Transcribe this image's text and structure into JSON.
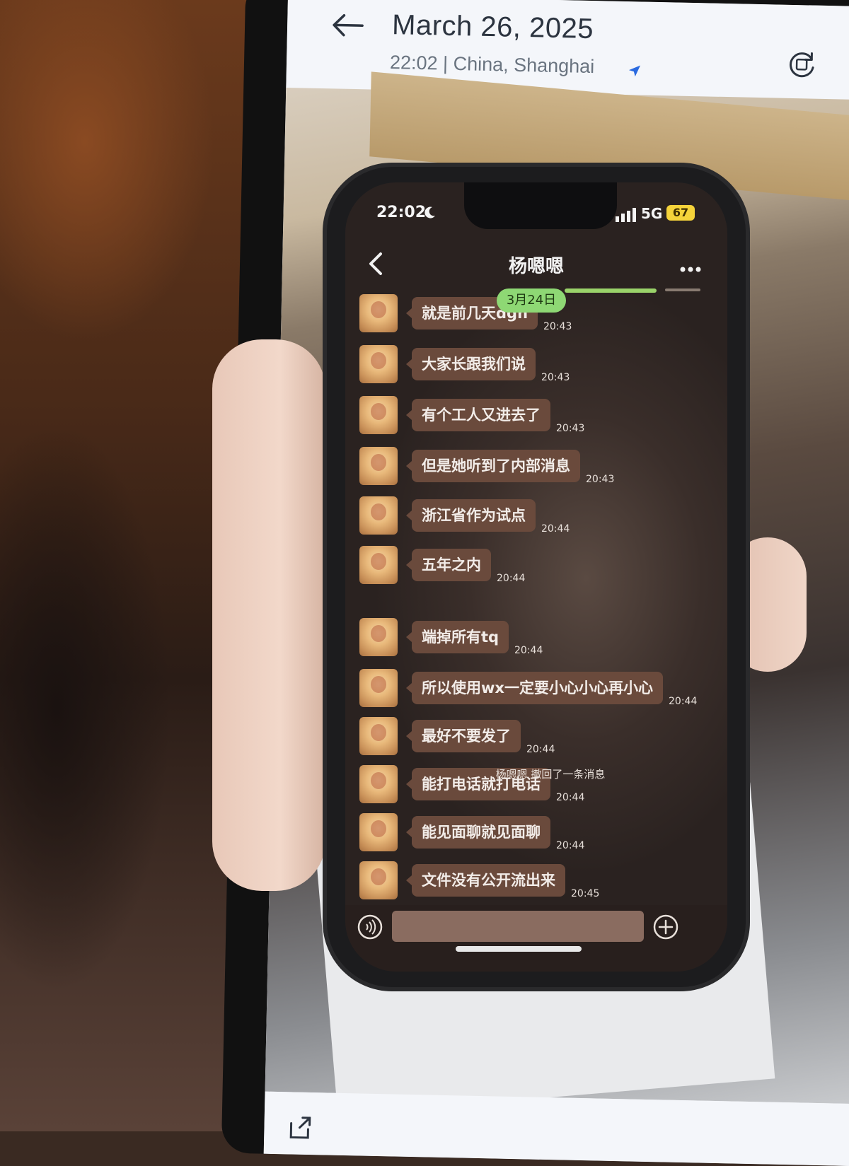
{
  "viewer": {
    "date": "March 26, 2025",
    "location": "22:02 | China, Shanghai"
  },
  "inner_phone": {
    "status_time": "22:02",
    "network": "5G",
    "battery": "67"
  },
  "chat": {
    "title": "杨嗯嗯",
    "date_chip": "3月24日",
    "recall_notice": "杨嗯嗯 撤回了一条消息",
    "messages": [
      {
        "text": "就是前几天dgh",
        "time": "20:43"
      },
      {
        "text": "大家长跟我们说",
        "time": "20:43"
      },
      {
        "text": "有个工人又进去了",
        "time": "20:43"
      },
      {
        "text": "但是她听到了内部消息",
        "time": "20:43"
      },
      {
        "text": "浙江省作为试点",
        "time": "20:44"
      },
      {
        "text": "五年之内",
        "time": "20:44"
      },
      {
        "text": "端掉所有tq",
        "time": "20:44"
      },
      {
        "text": "所以使用wx一定要小心小心再小心",
        "time": "20:44"
      },
      {
        "text": "最好不要发了",
        "time": "20:44"
      },
      {
        "text": "能打电话就打电话",
        "time": "20:44"
      },
      {
        "text": "能见面聊就见面聊",
        "time": "20:44"
      },
      {
        "text": "文件没有公开流出来",
        "time": "20:45"
      }
    ]
  },
  "icons": {
    "back": "arrow-left-icon",
    "rotate": "rotate-icon",
    "location": "location-arrow-icon",
    "voice": "voice-icon",
    "plus": "plus-icon",
    "share": "share-icon",
    "more": "more-icon"
  },
  "colors": {
    "date_chip": "#8ed874",
    "bubble": "#6a4a3c",
    "location_arrow": "#2a6ae0"
  }
}
